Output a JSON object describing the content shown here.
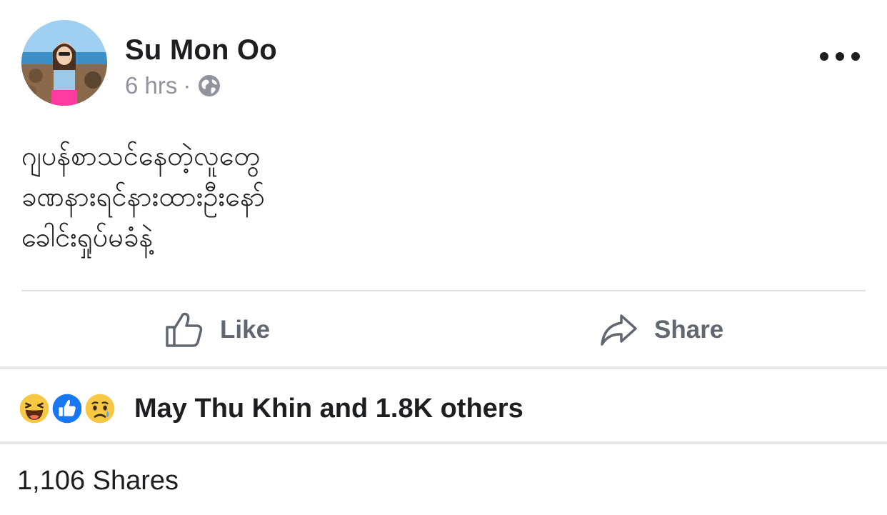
{
  "post": {
    "author": "Su Mon Oo",
    "time": "6 hrs",
    "privacy_icon": "globe-icon",
    "body_lines": [
      "ဂျပန်စာသင်နေတဲ့လူတွေ",
      "ခဏနားရင်နားထားဦးနော်",
      "ခေါင်းရှုပ်မခံနဲ့"
    ]
  },
  "actions": {
    "like_label": "Like",
    "share_label": "Share"
  },
  "reactions": {
    "icons": [
      "haha-reaction-icon",
      "like-reaction-icon",
      "sad-reaction-icon"
    ],
    "summary": "May Thu Khin and 1.8K others"
  },
  "shares": {
    "count_text": "1,106 Shares"
  },
  "colors": {
    "text_primary": "#1c1e21",
    "text_secondary": "#90949c",
    "action_gray": "#606770",
    "like_blue": "#1877f2",
    "divider": "#dddfe2"
  }
}
